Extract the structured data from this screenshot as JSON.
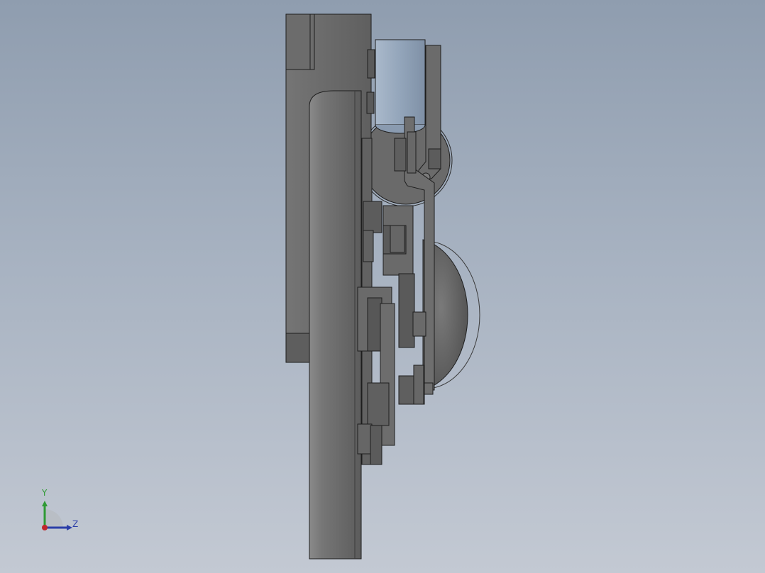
{
  "viewport": {
    "background_top": "#8f9daf",
    "background_bottom": "#c3c9d3",
    "part_color": "#6e6e6e",
    "transparent_part_color": "#9fb0c4",
    "edge_color": "#1e1e1e"
  },
  "triad": {
    "y_label": "Y",
    "z_label": "Z",
    "y_color": "#2f9a34",
    "z_color": "#2b3ea8",
    "x_color": "#c0262b"
  }
}
